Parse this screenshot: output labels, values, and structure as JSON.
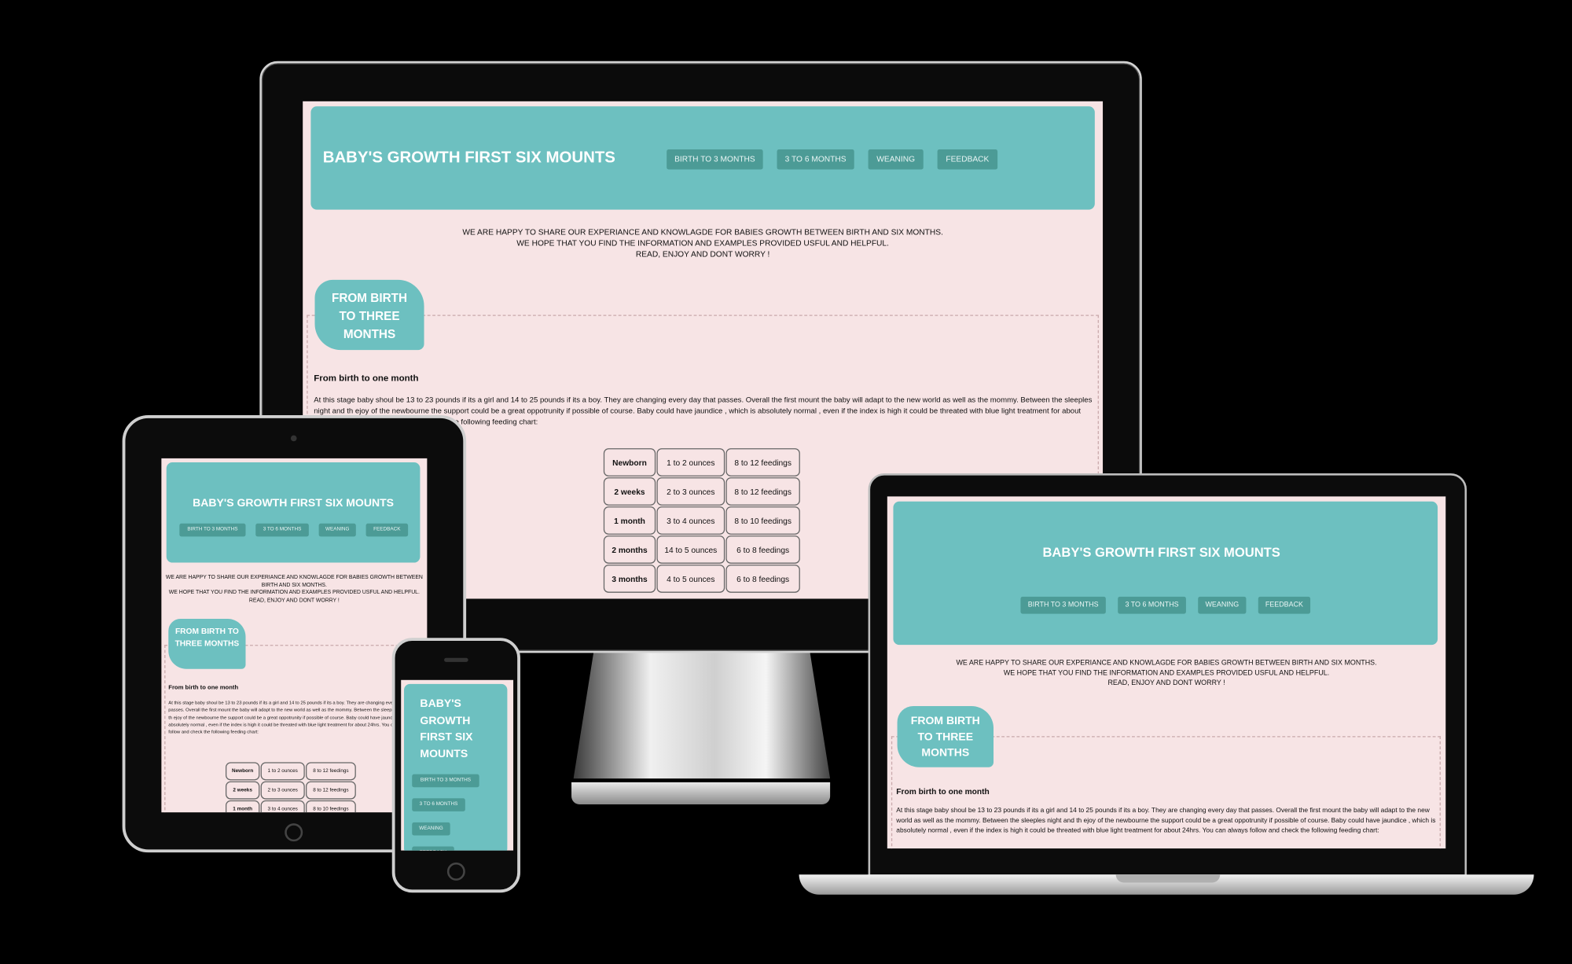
{
  "site": {
    "title": "BABY'S GROWTH FIRST SIX MOUNTS",
    "nav": [
      "BIRTH TO 3 MONTHS",
      "3 TO 6 MONTHS",
      "WEANING",
      "FEEDBACK"
    ],
    "intro_1": "WE ARE HAPPY TO SHARE OUR EXPERIANCE AND KNOWLAGDE FOR BABIES GROWTH BETWEEN BIRTH AND SIX MONTHS.",
    "intro_2": "WE HOPE THAT YOU FIND THE INFORMATION AND EXAMPLES PROVIDED USFUL AND HELPFUL.",
    "intro_3": "READ, ENJOY AND DONT WORRY !",
    "badge": "FROM BIRTH TO THREE MONTHS",
    "subheading": "From birth to one month",
    "paragraph": "At this stage baby shoul be 13 to 23 pounds if its a girl and 14 to 25 pounds if its a boy. They are changing every day that passes. Overall the first mount the baby will adapt to the new world as well as the mommy. Between the sleeples night and th ejoy of the newbourne the support could be a great oppotrunity if possible of course. Baby could have jaundice , which is absolutely normal , even if the index is high it could be threated with blue light treatment for about 24hrs. You can always follow and check the following feeding chart:",
    "feeding_chart": [
      [
        "Newborn",
        "1 to 2 ounces",
        "8 to 12 feedings"
      ],
      [
        "2 weeks",
        "2 to 3 ounces",
        "8 to 12 feedings"
      ],
      [
        "1 month",
        "3 to 4 ounces",
        "8 to 10 feedings"
      ],
      [
        "2 months",
        "14 to 5 ounces",
        "6 to 8 feedings"
      ],
      [
        "3 months",
        "4 to 5 ounces",
        "6 to 8 feedings"
      ]
    ]
  },
  "colors": {
    "header": "#6dc0c0",
    "button": "#4c9b96",
    "page": "#f7e4e5",
    "background": "#000000"
  }
}
